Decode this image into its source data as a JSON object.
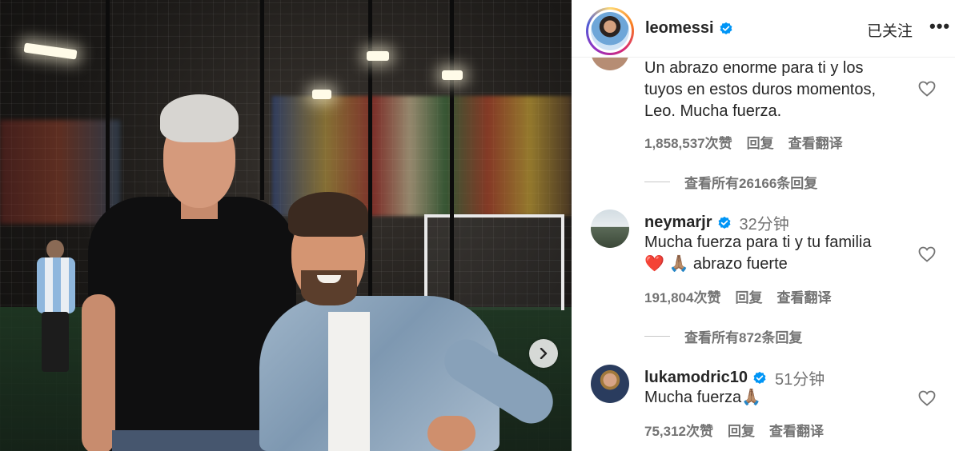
{
  "post": {
    "next_icon": "chevron-right-icon"
  },
  "header": {
    "username": "leomessi",
    "follow_label": "已关注",
    "more_label": "•••",
    "verified_color": "#0095f6"
  },
  "comments": [
    {
      "text_line_1": "Un abrazo enorme para ti y los",
      "text_line_2": "tuyos en estos duros momentos,",
      "text_line_3": "Leo. Mucha fuerza.",
      "likes": "1,858,537次赞",
      "reply_label": "回复",
      "translate_label": "查看翻译",
      "view_replies": "查看所有26166条回复"
    },
    {
      "username": "neymarjr",
      "time": "32分钟",
      "text_line_1": "Mucha fuerza para ti y tu familia",
      "text_line_2": "❤️ 🙏🏽 abrazo fuerte",
      "likes": "191,804次赞",
      "reply_label": "回复",
      "translate_label": "查看翻译",
      "view_replies": "查看所有872条回复"
    },
    {
      "username": "lukamodric10",
      "time": "51分钟",
      "text_line_1": "Mucha fuerza🙏🏽",
      "likes": "75,312次赞",
      "reply_label": "回复",
      "translate_label": "查看翻译"
    }
  ]
}
